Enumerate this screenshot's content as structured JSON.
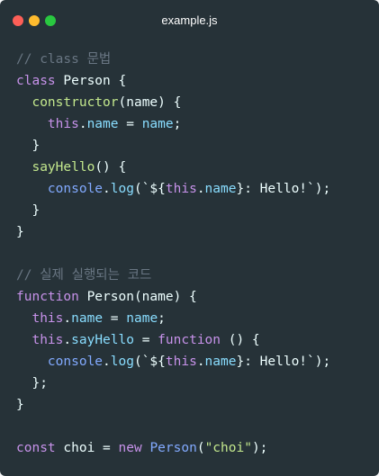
{
  "window": {
    "title": "example.js",
    "controls": [
      {
        "name": "close",
        "color": "#fd5f57"
      },
      {
        "name": "minimize",
        "color": "#febb2e"
      },
      {
        "name": "zoom",
        "color": "#29c840"
      }
    ]
  },
  "colors": {
    "background": "#263238",
    "comment": "#697683",
    "keyword": "#c792ea",
    "plain": "#eeffff",
    "function": "#c3e88d",
    "property": "#89ddff",
    "this": "#f07178",
    "string": "#c3e88d",
    "builtin": "#82aaff"
  },
  "code": {
    "lines": [
      [
        {
          "t": "comment",
          "v": "// class 문법"
        }
      ],
      [
        {
          "t": "keyword",
          "v": "class"
        },
        {
          "t": "plain",
          "v": " Person {"
        }
      ],
      [
        {
          "t": "plain",
          "v": "  "
        },
        {
          "t": "function",
          "v": "constructor"
        },
        {
          "t": "plain",
          "v": "(name) {"
        }
      ],
      [
        {
          "t": "plain",
          "v": "    "
        },
        {
          "t": "keyword",
          "v": "this"
        },
        {
          "t": "plain",
          "v": "."
        },
        {
          "t": "property",
          "v": "name"
        },
        {
          "t": "plain",
          "v": " = "
        },
        {
          "t": "property",
          "v": "name"
        },
        {
          "t": "plain",
          "v": ";"
        }
      ],
      [
        {
          "t": "plain",
          "v": "  }"
        }
      ],
      [
        {
          "t": "plain",
          "v": "  "
        },
        {
          "t": "function",
          "v": "sayHello"
        },
        {
          "t": "plain",
          "v": "() {"
        }
      ],
      [
        {
          "t": "plain",
          "v": "    "
        },
        {
          "t": "builtin",
          "v": "console"
        },
        {
          "t": "plain",
          "v": "."
        },
        {
          "t": "property",
          "v": "log"
        },
        {
          "t": "plain",
          "v": "(`${"
        },
        {
          "t": "keyword",
          "v": "this"
        },
        {
          "t": "plain",
          "v": "."
        },
        {
          "t": "property",
          "v": "name"
        },
        {
          "t": "plain",
          "v": "}: Hello!`);"
        }
      ],
      [
        {
          "t": "plain",
          "v": "  }"
        }
      ],
      [
        {
          "t": "plain",
          "v": "}"
        }
      ],
      [
        {
          "t": "plain",
          "v": ""
        }
      ],
      [
        {
          "t": "comment",
          "v": "// 실제 실행되는 코드"
        }
      ],
      [
        {
          "t": "keyword",
          "v": "function"
        },
        {
          "t": "plain",
          "v": " Person(name) {"
        }
      ],
      [
        {
          "t": "plain",
          "v": "  "
        },
        {
          "t": "keyword",
          "v": "this"
        },
        {
          "t": "plain",
          "v": "."
        },
        {
          "t": "property",
          "v": "name"
        },
        {
          "t": "plain",
          "v": " = "
        },
        {
          "t": "property",
          "v": "name"
        },
        {
          "t": "plain",
          "v": ";"
        }
      ],
      [
        {
          "t": "plain",
          "v": "  "
        },
        {
          "t": "keyword",
          "v": "this"
        },
        {
          "t": "plain",
          "v": "."
        },
        {
          "t": "property",
          "v": "sayHello"
        },
        {
          "t": "plain",
          "v": " = "
        },
        {
          "t": "keyword",
          "v": "function"
        },
        {
          "t": "plain",
          "v": " () {"
        }
      ],
      [
        {
          "t": "plain",
          "v": "    "
        },
        {
          "t": "builtin",
          "v": "console"
        },
        {
          "t": "plain",
          "v": "."
        },
        {
          "t": "property",
          "v": "log"
        },
        {
          "t": "plain",
          "v": "(`${"
        },
        {
          "t": "keyword",
          "v": "this"
        },
        {
          "t": "plain",
          "v": "."
        },
        {
          "t": "property",
          "v": "name"
        },
        {
          "t": "plain",
          "v": "}: Hello!`);"
        }
      ],
      [
        {
          "t": "plain",
          "v": "  };"
        }
      ],
      [
        {
          "t": "plain",
          "v": "}"
        }
      ],
      [
        {
          "t": "plain",
          "v": ""
        }
      ],
      [
        {
          "t": "keyword",
          "v": "const"
        },
        {
          "t": "plain",
          "v": " choi = "
        },
        {
          "t": "keyword",
          "v": "new"
        },
        {
          "t": "plain",
          "v": " "
        },
        {
          "t": "builtin",
          "v": "Person"
        },
        {
          "t": "plain",
          "v": "("
        },
        {
          "t": "string",
          "v": "\"choi\""
        },
        {
          "t": "plain",
          "v": ");"
        }
      ]
    ]
  }
}
